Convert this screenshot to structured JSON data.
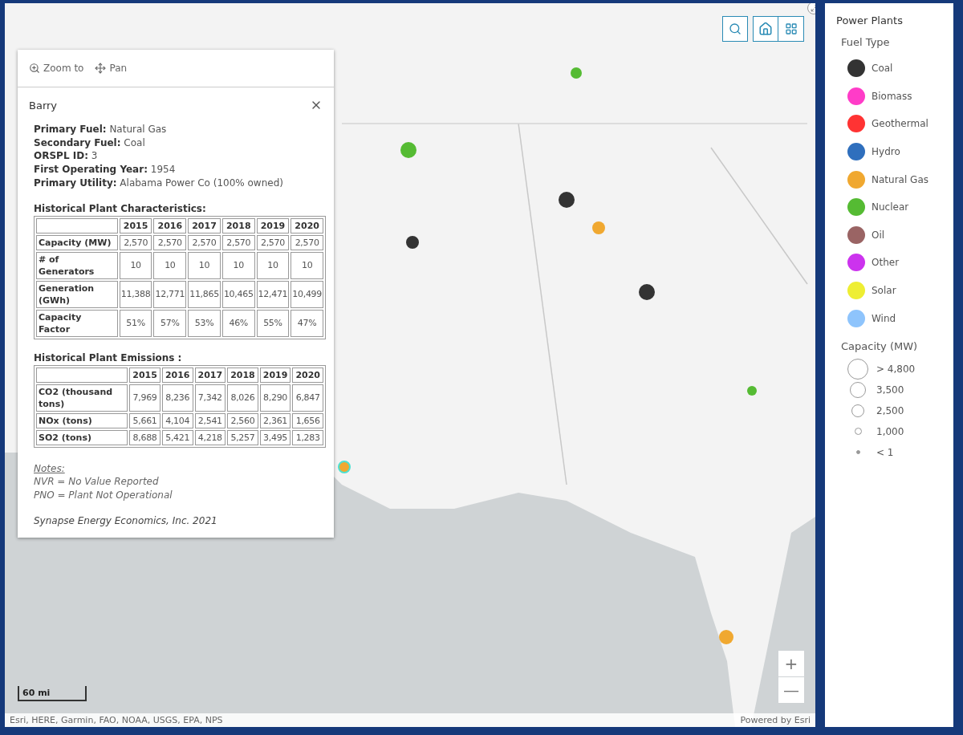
{
  "map": {
    "scale": "60 mi",
    "attribution": "Esri, HERE, Garmin, FAO, NOAA, USGS, EPA, NPS",
    "powered_by": "Powered by Esri",
    "zoom_in": "+",
    "zoom_out": "—"
  },
  "popup": {
    "actions": [
      {
        "kind": "zoom",
        "label": "Zoom to"
      },
      {
        "kind": "pan",
        "label": "Pan"
      }
    ],
    "title": "Barry",
    "fields": [
      {
        "label": "Primary Fuel:",
        "value": "Natural Gas"
      },
      {
        "label": "Secondary Fuel:",
        "value": "Coal"
      },
      {
        "label": "ORSPL ID:",
        "value": "3"
      },
      {
        "label": "First Operating Year:",
        "value": "1954"
      },
      {
        "label": "Primary Utility:",
        "value": "Alabama Power Co (100% owned)"
      }
    ],
    "characteristics": {
      "title": "Historical Plant Characteristics:",
      "columns": [
        "2015",
        "2016",
        "2017",
        "2018",
        "2019",
        "2020"
      ],
      "rows": [
        {
          "label": "Capacity (MW)",
          "cells": [
            "2,570",
            "2,570",
            "2,570",
            "2,570",
            "2,570",
            "2,570"
          ]
        },
        {
          "label": "# of Generators",
          "cells": [
            "10",
            "10",
            "10",
            "10",
            "10",
            "10"
          ]
        },
        {
          "label": "Generation (GWh)",
          "cells": [
            "11,388",
            "12,771",
            "11,865",
            "10,465",
            "12,471",
            "10,499"
          ]
        },
        {
          "label": "Capacity Factor",
          "cells": [
            "51%",
            "57%",
            "53%",
            "46%",
            "55%",
            "47%"
          ]
        }
      ]
    },
    "emissions": {
      "title": "Historical Plant Emissions :",
      "columns": [
        "2015",
        "2016",
        "2017",
        "2018",
        "2019",
        "2020"
      ],
      "rows": [
        {
          "label": "CO2 (thousand tons)",
          "cells": [
            "7,969",
            "8,236",
            "7,342",
            "8,026",
            "8,290",
            "6,847"
          ]
        },
        {
          "label": "NOx (tons)",
          "cells": [
            "5,661",
            "4,104",
            "2,541",
            "2,560",
            "2,361",
            "1,656"
          ]
        },
        {
          "label": "SO2 (tons)",
          "cells": [
            "8,688",
            "5,421",
            "4,218",
            "5,257",
            "3,495",
            "1,283"
          ]
        }
      ]
    },
    "notes": {
      "title": "Notes:",
      "lines": [
        "NVR = No Value Reported",
        "PNO = Plant Not Operational"
      ]
    },
    "footer": "Synapse Energy Economics, Inc. 2021"
  },
  "legend": {
    "title": "Power Plants",
    "fuel_title": "Fuel Type",
    "fuels": [
      {
        "label": "Coal",
        "color": "#333333"
      },
      {
        "label": "Biomass",
        "color": "#ff3cc8"
      },
      {
        "label": "Geothermal",
        "color": "#ff3333"
      },
      {
        "label": "Hydro",
        "color": "#2f6fbd"
      },
      {
        "label": "Natural Gas",
        "color": "#f0a830"
      },
      {
        "label": "Nuclear",
        "color": "#55bb33"
      },
      {
        "label": "Oil",
        "color": "#9a6464"
      },
      {
        "label": "Other",
        "color": "#cc33ee"
      },
      {
        "label": "Solar",
        "color": "#eeee33"
      },
      {
        "label": "Wind",
        "color": "#8ec4fc"
      }
    ],
    "capacity_title": "Capacity (MW)",
    "capacity": [
      {
        "label": "> 4,800"
      },
      {
        "label": "3,500"
      },
      {
        "label": "2,500"
      },
      {
        "label": "1,000"
      },
      {
        "label": "< 1"
      }
    ]
  }
}
